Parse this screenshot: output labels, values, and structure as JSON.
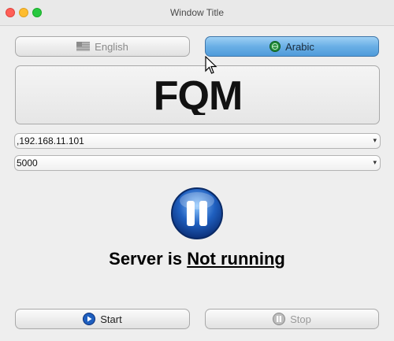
{
  "window": {
    "title": "Window Title"
  },
  "language": {
    "english_label": "English",
    "arabic_label": "Arabic",
    "selected": "Arabic"
  },
  "logo": {
    "text": "FQM"
  },
  "connection": {
    "ip_value": ",192.168.11.101",
    "port_value": "5000"
  },
  "status": {
    "prefix": "Server is ",
    "value": "Not running "
  },
  "controls": {
    "start_label": "Start",
    "stop_label": "Stop"
  },
  "colors": {
    "accent_selected": "#6aafe6",
    "status_icon": "#1f5fbf"
  }
}
